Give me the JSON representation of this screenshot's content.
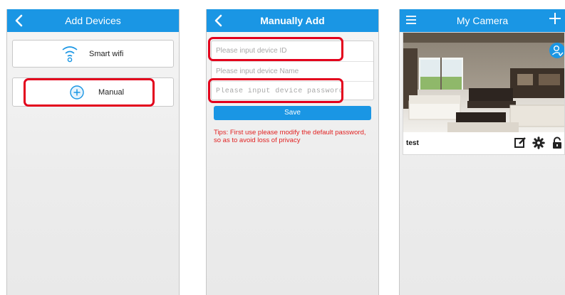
{
  "screen1": {
    "title": "Add Devices",
    "items": [
      {
        "label": "Smart wifi",
        "icon": "wifi-icon"
      },
      {
        "label": "Manual",
        "icon": "plus-circle-icon"
      }
    ]
  },
  "screen2": {
    "title": "Manually Add",
    "device_id_placeholder": "Please input device ID",
    "device_name_placeholder": "Please input device Name",
    "device_password_placeholder": "Please input device password",
    "save_label": "Save",
    "tips": "Tips: First use please modify the default password, so as to avoid loss of privacy"
  },
  "screen3": {
    "title": "My Camera",
    "camera_name": "test",
    "actions": [
      "edit-icon",
      "settings-icon",
      "lock-icon"
    ]
  },
  "colors": {
    "header": "#1a96e4",
    "highlight": "#e3001c",
    "tips": "#e12222"
  }
}
